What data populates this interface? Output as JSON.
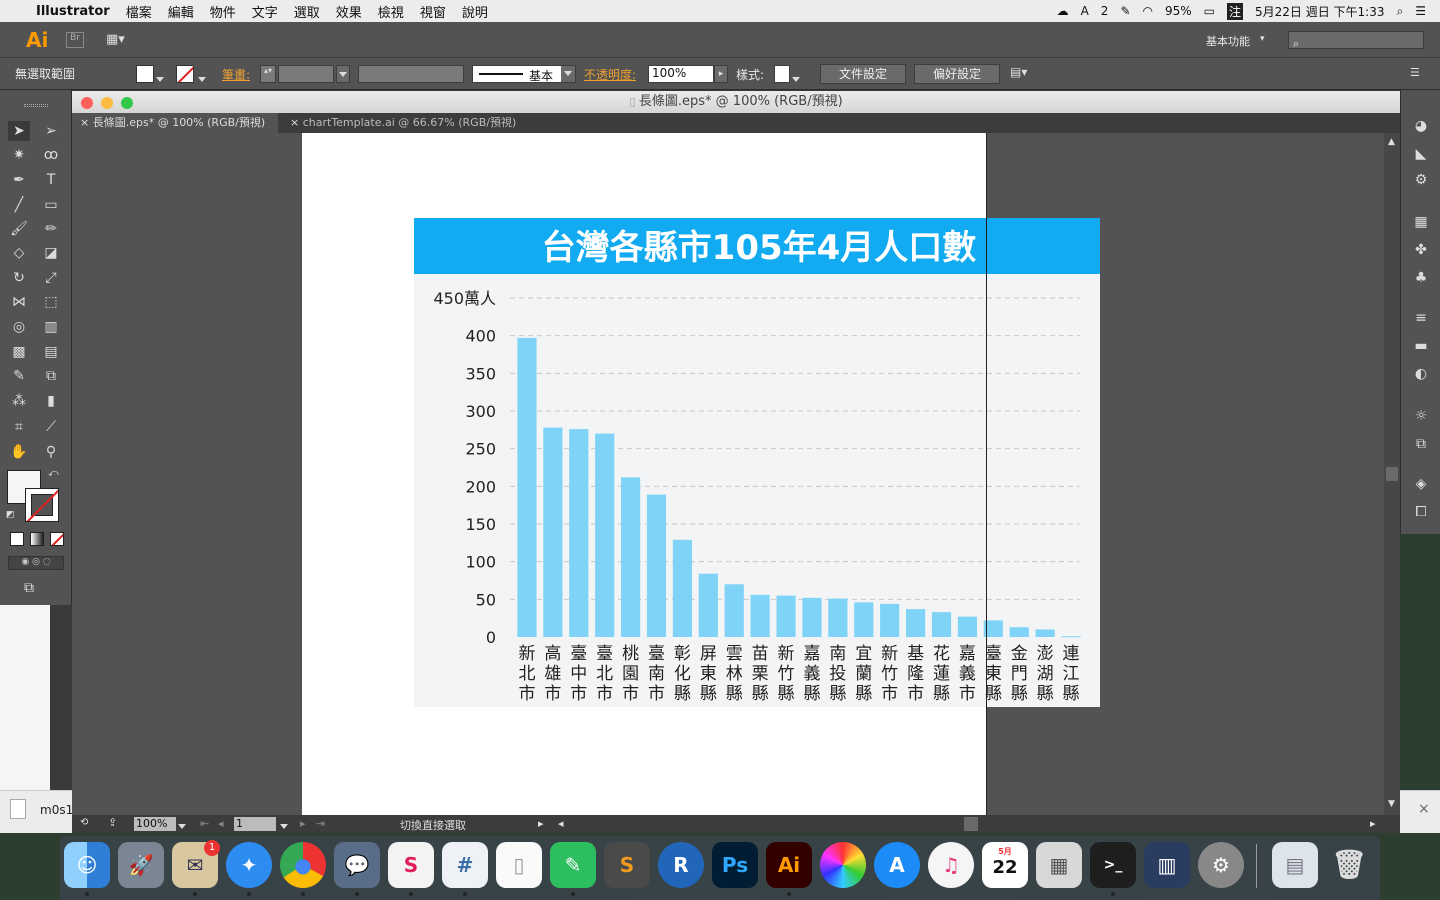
{
  "menubar": {
    "items": [
      "Illustrator",
      "檔案",
      "編輯",
      "物件",
      "文字",
      "選取",
      "效果",
      "檢視",
      "視窗",
      "說明"
    ],
    "status": {
      "ai_count": "2",
      "battery": "95%",
      "input": "注",
      "datetime": "5月22日 週日 下午1:33"
    }
  },
  "appbar": {
    "logo": "Ai",
    "workspace": "基本功能"
  },
  "control": {
    "selection": "無選取範圍",
    "stroke_label": "筆畫:",
    "stroke_style": "基本",
    "opacity_label": "不透明度:",
    "opacity_value": "100%",
    "style_label": "樣式:",
    "doc_setup": "文件設定",
    "prefs": "偏好設定"
  },
  "document": {
    "window_title": "長條圖.eps* @ 100% (RGB/預視)",
    "tabs": [
      {
        "label": "長條圖.eps* @ 100% (RGB/預視)",
        "active": true
      },
      {
        "label": "chartTemplate.ai @ 66.67% (RGB/預視)",
        "active": false
      }
    ],
    "status": {
      "zoom": "100%",
      "artboard": "1",
      "message": "切換直接選取"
    }
  },
  "chart_data": {
    "type": "bar",
    "title": "台灣各縣市105年4月人口數",
    "ylabel": "萬人",
    "ylim": [
      0,
      450
    ],
    "yticks": [
      0,
      50,
      100,
      150,
      200,
      250,
      300,
      350,
      400,
      450
    ],
    "ytick_labels": [
      "0",
      "50",
      "100",
      "150",
      "200",
      "250",
      "300",
      "350",
      "400",
      "450萬人"
    ],
    "grid": true,
    "categories": [
      "新北市",
      "高雄市",
      "臺中市",
      "臺北市",
      "桃園市",
      "臺南市",
      "彰化縣",
      "屏東縣",
      "雲林縣",
      "苗栗縣",
      "新竹縣",
      "嘉義縣",
      "南投縣",
      "宜蘭縣",
      "新竹市",
      "基隆市",
      "花蓮縣",
      "嘉義市",
      "臺東縣",
      "金門縣",
      "澎湖縣",
      "連江縣"
    ],
    "values": [
      397,
      278,
      276,
      270,
      212,
      189,
      129,
      84,
      70,
      56,
      55,
      52,
      51,
      46,
      44,
      37,
      33,
      27,
      22,
      13,
      10,
      1
    ],
    "colors": {
      "bar": "#7fd3f7",
      "title_bg": "#12aaf0",
      "title_text": "#ffffff",
      "plot_bg": "#f2f4f5",
      "grid": "#c8c8c8"
    }
  },
  "dock": {
    "apps": [
      "Finder",
      "Launchpad",
      "Mail",
      "Safari",
      "Chrome",
      "Messages",
      "Slack",
      "Slack Notes",
      "TextEdit",
      "Evernote",
      "Sublime Text",
      "R",
      "Photoshop",
      "Illustrator",
      "Color Picker",
      "App Store",
      "iTunes",
      "Calendar",
      "Calculator",
      "Terminal",
      "Activity",
      "System Preferences",
      "Documents",
      "Trash"
    ],
    "badges": {
      "mail": "1"
    },
    "calendar": {
      "month": "5月",
      "day": "22"
    }
  },
  "finder": {
    "file_label": "m0s1"
  }
}
